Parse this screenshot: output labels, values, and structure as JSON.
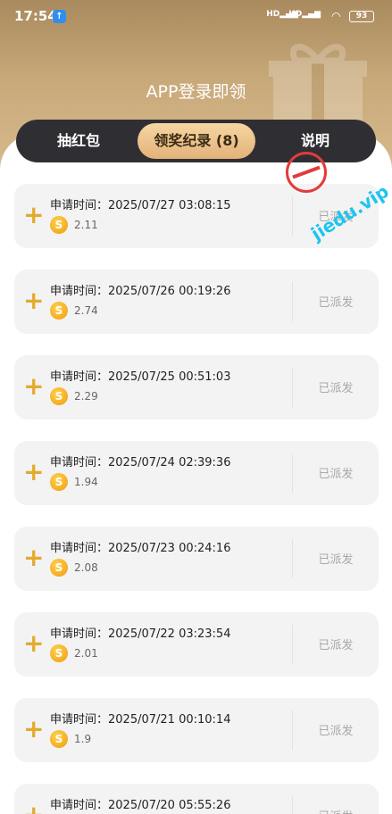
{
  "status_bar": {
    "time": "17:54",
    "signal_1": "HD",
    "signal_2": "HD",
    "battery": "93"
  },
  "header": {
    "title": "APP登录即领"
  },
  "tabs": [
    {
      "label": "抽红包",
      "active": false
    },
    {
      "label": "领奖纪录 (8)",
      "active": true
    },
    {
      "label": "说明",
      "active": false
    }
  ],
  "records": [
    {
      "label": "申请时间：",
      "time": "2025/07/27 03:08:15",
      "amount": "2.11",
      "status": "已派发"
    },
    {
      "label": "申请时间：",
      "time": "2025/07/26 00:19:26",
      "amount": "2.74",
      "status": "已派发"
    },
    {
      "label": "申请时间：",
      "time": "2025/07/25 00:51:03",
      "amount": "2.29",
      "status": "已派发"
    },
    {
      "label": "申请时间：",
      "time": "2025/07/24 02:39:36",
      "amount": "1.94",
      "status": "已派发"
    },
    {
      "label": "申请时间：",
      "time": "2025/07/23 00:24:16",
      "amount": "2.08",
      "status": "已派发"
    },
    {
      "label": "申请时间：",
      "time": "2025/07/22 03:23:54",
      "amount": "2.01",
      "status": "已派发"
    },
    {
      "label": "申请时间：",
      "time": "2025/07/21 00:10:14",
      "amount": "1.9",
      "status": "已派发"
    },
    {
      "label": "申请时间：",
      "time": "2025/07/20 05:55:26",
      "amount": "",
      "status": "已派发"
    }
  ],
  "icons": {
    "expand": "+",
    "coin": "S"
  },
  "watermark": {
    "text": "jiedu.vip"
  },
  "colors": {
    "header_gold": "#c8a97a",
    "tab_bar": "#2f2f33",
    "active_tab": "#e9bd85",
    "plus": "#e3aa2c",
    "coin": "#f5b625"
  }
}
